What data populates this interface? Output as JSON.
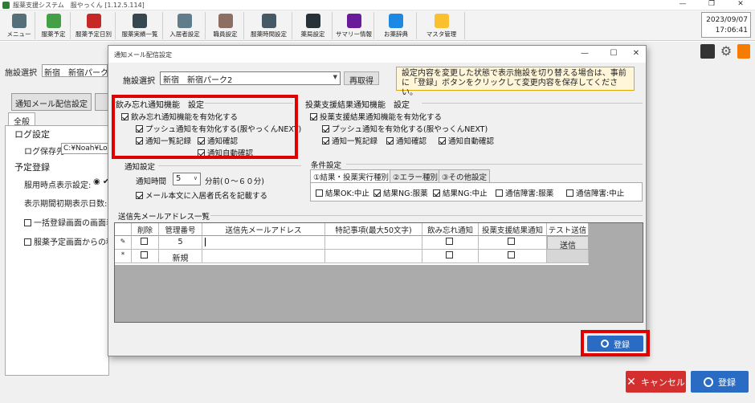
{
  "app": {
    "title": "服薬支援システム　服やっくん [1.12.5.114]",
    "clock_date": "2023/09/07",
    "clock_time": "17:06:41"
  },
  "toolbar": [
    {
      "label": "メニュー",
      "icon": "menu-icon"
    },
    {
      "label": "服薬予定",
      "icon": "pill-icon"
    },
    {
      "label": "服薬予定日別",
      "icon": "calendar-icon"
    },
    {
      "label": "服薬実績一覧",
      "icon": "list-icon"
    },
    {
      "label": "入居者設定",
      "icon": "resident-icon"
    },
    {
      "label": "職員設定",
      "icon": "staff-icon"
    },
    {
      "label": "服薬時間設定",
      "icon": "clock-icon"
    },
    {
      "label": "薬局設定",
      "icon": "pharmacy-icon"
    },
    {
      "label": "サマリー情報",
      "icon": "summary-chart-icon"
    },
    {
      "label": "お薬辞典",
      "icon": "book-icon"
    },
    {
      "label": "マスタ管理",
      "icon": "lock-icon"
    }
  ],
  "background": {
    "facility_label": "施設選択",
    "facility_value": "新宿　新宿パーク",
    "notify_button": "通知メール配信設定",
    "tab_general": "全般",
    "log_settings": "ログ設定",
    "log_path_label": "ログ保存先",
    "log_path_value": "C:¥Noah¥Log",
    "schedule_registration": "予定登録",
    "time_display_label": "服用時点表示設定:",
    "period_initial_label": "表示期間初期表示日数:",
    "bulk_register_label": "一括登録画面の画面表",
    "schedule_screen_label": "服薬予定画面からの移",
    "cancel_button": "キャンセル",
    "register_button": "登録"
  },
  "dialog": {
    "title": "通知メール配信設定",
    "facility_label": "施設選択",
    "facility_value": "新宿　新宿パーク2",
    "reacquire_button": "再取得",
    "notice": "設定内容を変更した状態で表示施設を切り替える場合は、事前に「登録」ボタンをクリックして変更内容を保存してください。",
    "forget": {
      "section": "飲み忘れ通知機能　設定",
      "enable": "飲み忘れ通知機能を有効化する",
      "push": "プッシュ通知を有効化する(服やっくんNEXT)",
      "list_record": "通知一覧記録",
      "confirm": "通知確認",
      "auto_confirm": "通知自動確認"
    },
    "notify_settings": {
      "section": "通知設定",
      "time_label": "通知時間",
      "time_value": "5",
      "time_suffix": "分前(０～６０分)",
      "include_name": "メール本文に入居者氏名を記載する"
    },
    "result": {
      "section": "投薬支援結果通知機能　設定",
      "enable": "投薬支援結果通知機能を有効化する",
      "push": "プッシュ通知を有効化する(服やっくんNEXT)",
      "list_record": "通知一覧記録",
      "confirm": "通知確認",
      "auto_confirm": "通知自動確認"
    },
    "conditions": {
      "section": "条件設定",
      "tabs": [
        "①結果・投薬実行種別",
        "②エラー種別",
        "③その他設定"
      ],
      "items": [
        {
          "label": "結果OK:中止",
          "checked": false
        },
        {
          "label": "結果NG:服薬",
          "checked": true
        },
        {
          "label": "結果NG:中止",
          "checked": true
        },
        {
          "label": "通信障害:服薬",
          "checked": false
        },
        {
          "label": "通信障害:中止",
          "checked": false
        }
      ]
    },
    "address_list": {
      "section": "送信先メールアドレス一覧",
      "columns": [
        "削除",
        "管理番号",
        "送信先メールアドレス",
        "特記事項(最大50文字)",
        "飲み忘れ通知",
        "投薬支援結果通知",
        "テスト送信"
      ],
      "rows": [
        {
          "marker": "✎",
          "id": "5",
          "email": "",
          "note": "",
          "send": "送信"
        },
        {
          "marker": "*",
          "id": "新規",
          "email": "",
          "note": "",
          "send": ""
        }
      ]
    },
    "register_button": "登録"
  },
  "colors": {
    "highlight": "#e10000",
    "register_blue": "#2a6cc4",
    "cancel_red": "#d32f2f",
    "notice_bg": "#fff6d9"
  }
}
